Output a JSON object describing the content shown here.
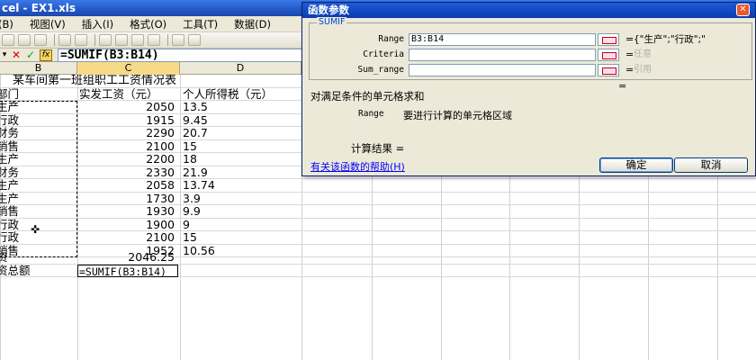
{
  "window": {
    "title": "cel - EX1.xls"
  },
  "menubar": {
    "items": [
      "(B)",
      "视图(V)",
      "插入(I)",
      "格式(O)",
      "工具(T)",
      "数据(D)"
    ]
  },
  "formula_bar": {
    "cancel": "✕",
    "enter": "✓",
    "fx": "fx",
    "content": "=SUMIF(B3:B14)"
  },
  "columns": {
    "b": "B",
    "c": "C",
    "d": "D"
  },
  "sheet": {
    "title": "某车间第一班组职工工资情况表",
    "headers": {
      "b": "部门",
      "c": "实发工资（元）",
      "d": "个人所得税（元）"
    },
    "rows": [
      {
        "dept": "生产",
        "salary": "2050",
        "tax": "13.5"
      },
      {
        "dept": "行政",
        "salary": "1915",
        "tax": "9.45"
      },
      {
        "dept": "财务",
        "salary": "2290",
        "tax": "20.7"
      },
      {
        "dept": "销售",
        "salary": "2100",
        "tax": "15"
      },
      {
        "dept": "生产",
        "salary": "2200",
        "tax": "18"
      },
      {
        "dept": "财务",
        "salary": "2330",
        "tax": "21.9"
      },
      {
        "dept": "生产",
        "salary": "2058",
        "tax": "13.74"
      },
      {
        "dept": "生产",
        "salary": "1730",
        "tax": "3.9"
      },
      {
        "dept": "销售",
        "salary": "1930",
        "tax": "9.9"
      },
      {
        "dept": "行政",
        "salary": "1900",
        "tax": "9"
      },
      {
        "dept": "行政",
        "salary": "2100",
        "tax": "15"
      },
      {
        "dept": "销售",
        "salary": "1952",
        "tax": "10.56"
      }
    ],
    "avg_label": "资",
    "avg_value": "2046.25",
    "total_label": "资总额",
    "total_formula": "=SUMIF(B3:B14)"
  },
  "dialog": {
    "title": "函数参数",
    "close": "✕",
    "group_label": "SUMIF",
    "args": [
      {
        "label": "Range",
        "value": "B3:B14",
        "result": "{\"生产\";\"行政\";\""
      },
      {
        "label": "Criteria",
        "value": "",
        "result": "任意"
      },
      {
        "label": "Sum_range",
        "value": "",
        "result": "引用"
      }
    ],
    "result_eq": "=",
    "description": "对满足条件的单元格求和",
    "param_name": "Range",
    "param_desc": "要进行计算的单元格区域",
    "calc_result_label": "计算结果 =",
    "help_link": "有关该函数的帮助(H)",
    "ok_label": "确定",
    "cancel_label": "取消"
  }
}
